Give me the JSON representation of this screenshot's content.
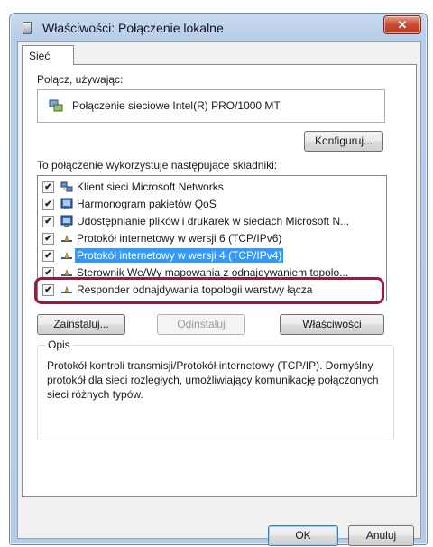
{
  "window": {
    "title": "Właściwości: Połączenie lokalne",
    "close_label": "✕"
  },
  "tabs": [
    {
      "label": "Sieć",
      "active": true
    }
  ],
  "connect": {
    "label": "Połącz, używając:",
    "adapter": "Połączenie sieciowe Intel(R) PRO/1000 MT",
    "configure_button": "Konfiguruj..."
  },
  "components": {
    "label": "To połączenie wykorzystuje następujące składniki:",
    "items": [
      {
        "label": "Klient sieci Microsoft Networks",
        "checked": true,
        "icon": "network-client-icon"
      },
      {
        "label": "Harmonogram pakietów QoS",
        "checked": true,
        "icon": "service-icon"
      },
      {
        "label": "Udostępnianie plików i drukarek w sieciach Microsoft N...",
        "checked": true,
        "icon": "service-icon"
      },
      {
        "label": "Protokół internetowy w wersji 6 (TCP/IPv6)",
        "checked": true,
        "icon": "protocol-icon"
      },
      {
        "label": "Protokół internetowy w wersji 4 (TCP/IPv4)",
        "checked": true,
        "icon": "protocol-icon",
        "selected": true
      },
      {
        "label": "Sterownik We/Wy mapowania z odnajdywaniem topolo...",
        "checked": true,
        "icon": "protocol-icon"
      },
      {
        "label": "Responder odnajdywania topologii warstwy łącza",
        "checked": true,
        "icon": "protocol-icon"
      }
    ]
  },
  "buttons": {
    "install": "Zainstaluj...",
    "uninstall": "Odinstaluj",
    "properties": "Właściwości",
    "ok": "OK",
    "cancel": "Anuluj"
  },
  "description": {
    "label": "Opis",
    "text": "Protokół kontroli transmisji/Protokół internetowy (TCP/IP). Domyślny protokół dla sieci rozległych, umożliwiający komunikację połączonych sieci różnych typów."
  },
  "colors": {
    "selection": "#3399ff",
    "highlight_frame": "#9b1b3a",
    "close_button": "#c74a32"
  }
}
